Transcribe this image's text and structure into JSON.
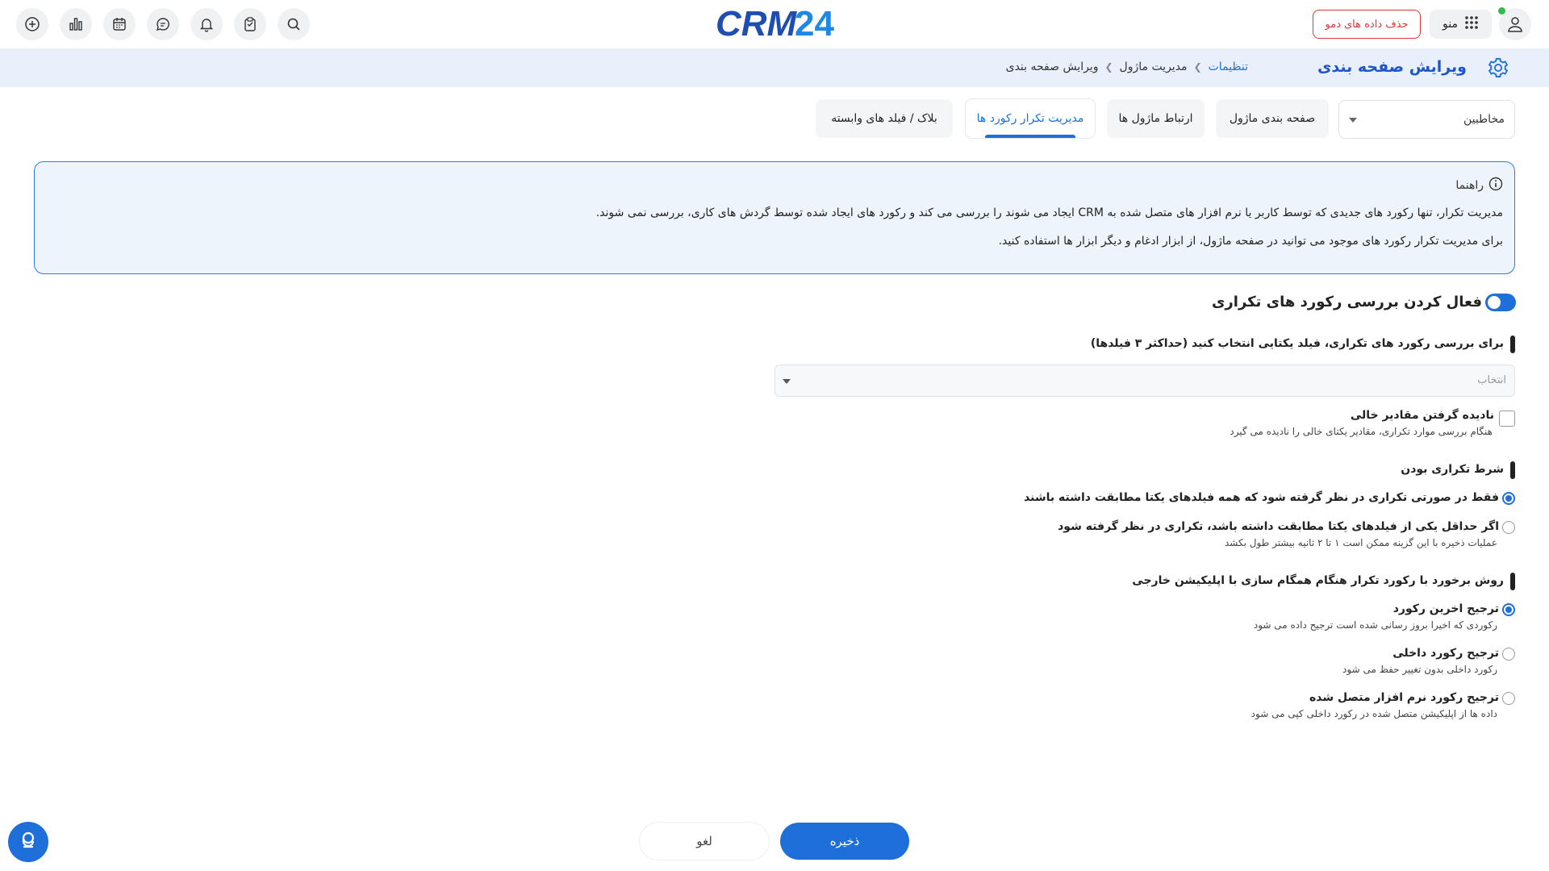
{
  "topbar": {
    "logo_text": "CRM24",
    "demo_button": "حذف داده های دمو",
    "menu_label": "منو",
    "icons": [
      "add-icon",
      "chart-icon",
      "calendar-icon",
      "chat-icon",
      "bell-icon",
      "clipboard-icon",
      "search-icon",
      "grid-icon",
      "user-icon"
    ]
  },
  "header": {
    "title": "ویرایش صفحه بندی",
    "breadcrumb": [
      "تنظیمات",
      "مدیریت ماژول",
      "ویرایش صفحه بندی"
    ]
  },
  "module_select": {
    "value": "مخاطبین"
  },
  "tabs": [
    {
      "label": "صفحه بندی ماژول"
    },
    {
      "label": "ارتباط ماژول ها"
    },
    {
      "label": "مدیریت تکرار رکورد ها",
      "active": true
    },
    {
      "label": "بلاک / فیلد های وابسته"
    }
  ],
  "info": {
    "title": "راهنما",
    "line1": "مدیریت تکرار، تنها رکورد های جدیدی که توسط کاربر یا نرم افزار های متصل شده به CRM ایجاد می شوند را بررسی می کند و رکورد های ایجاد شده توسط گردش های کاری، بررسی نمی شوند.",
    "line2": "برای مدیریت تکرار رکورد های موجود می توانید در صفحه ماژول، از ابزار ادغام و دیگر ابزار ها استفاده کنید."
  },
  "form": {
    "enable_heading": "فعال کردن بررسی رکورد های تکراری",
    "unique_field_label": "برای بررسی رکورد های تکراری، فیلد یکتایی انتخاب کنید (حداکثر ۳ فیلدها)",
    "unique_field_placeholder": "انتخاب",
    "ignore_empty_title": "نادیده گرفتن مقادیر خالی",
    "ignore_empty_sub": "هنگام بررسی موارد تکراری، مقادیر یکتای خالی را نادیده می گیرد",
    "duplicate_condition_label": "شرط تکراری بودن",
    "condition_all": "فقط در صورتی تکراری در نظر گرفته شود که همه فیلدهای یکتا مطابقت داشته باشند",
    "condition_any": "اگر حداقل یکی از فیلدهای یکتا مطابقت داشته باشد، تکراری در نظر گرفته شود",
    "condition_any_sub": "عملیات ذخیره با این گزینه ممکن است ۱ تا ۲ ثانیه بیشتر طول بکشد",
    "sync_label": "روش برخورد با رکورد تکرار هنگام همگام سازی با اپلیکیشن خارجی",
    "sync_latest_title": "ترجیح اخرین رکورد",
    "sync_latest_sub": "رکوردی که اخیرا بروز رسانی شده است ترجیح داده می شود",
    "sync_internal_title": "ترجیح رکورد داخلی",
    "sync_internal_sub": "رکورد داخلی بدون تغییر حفظ می شود",
    "sync_external_title": "ترجیح رکورد نرم افزار متصل شده",
    "sync_external_sub": "داده ها از اپلیکیشن متصل شده در رکورد داخلی کپی می شود"
  },
  "buttons": {
    "save": "ذخیره",
    "cancel": "لغو"
  },
  "colors": {
    "primary": "#1e6fd9",
    "danger": "#e0353b",
    "header_bg": "#e9f0fb"
  }
}
